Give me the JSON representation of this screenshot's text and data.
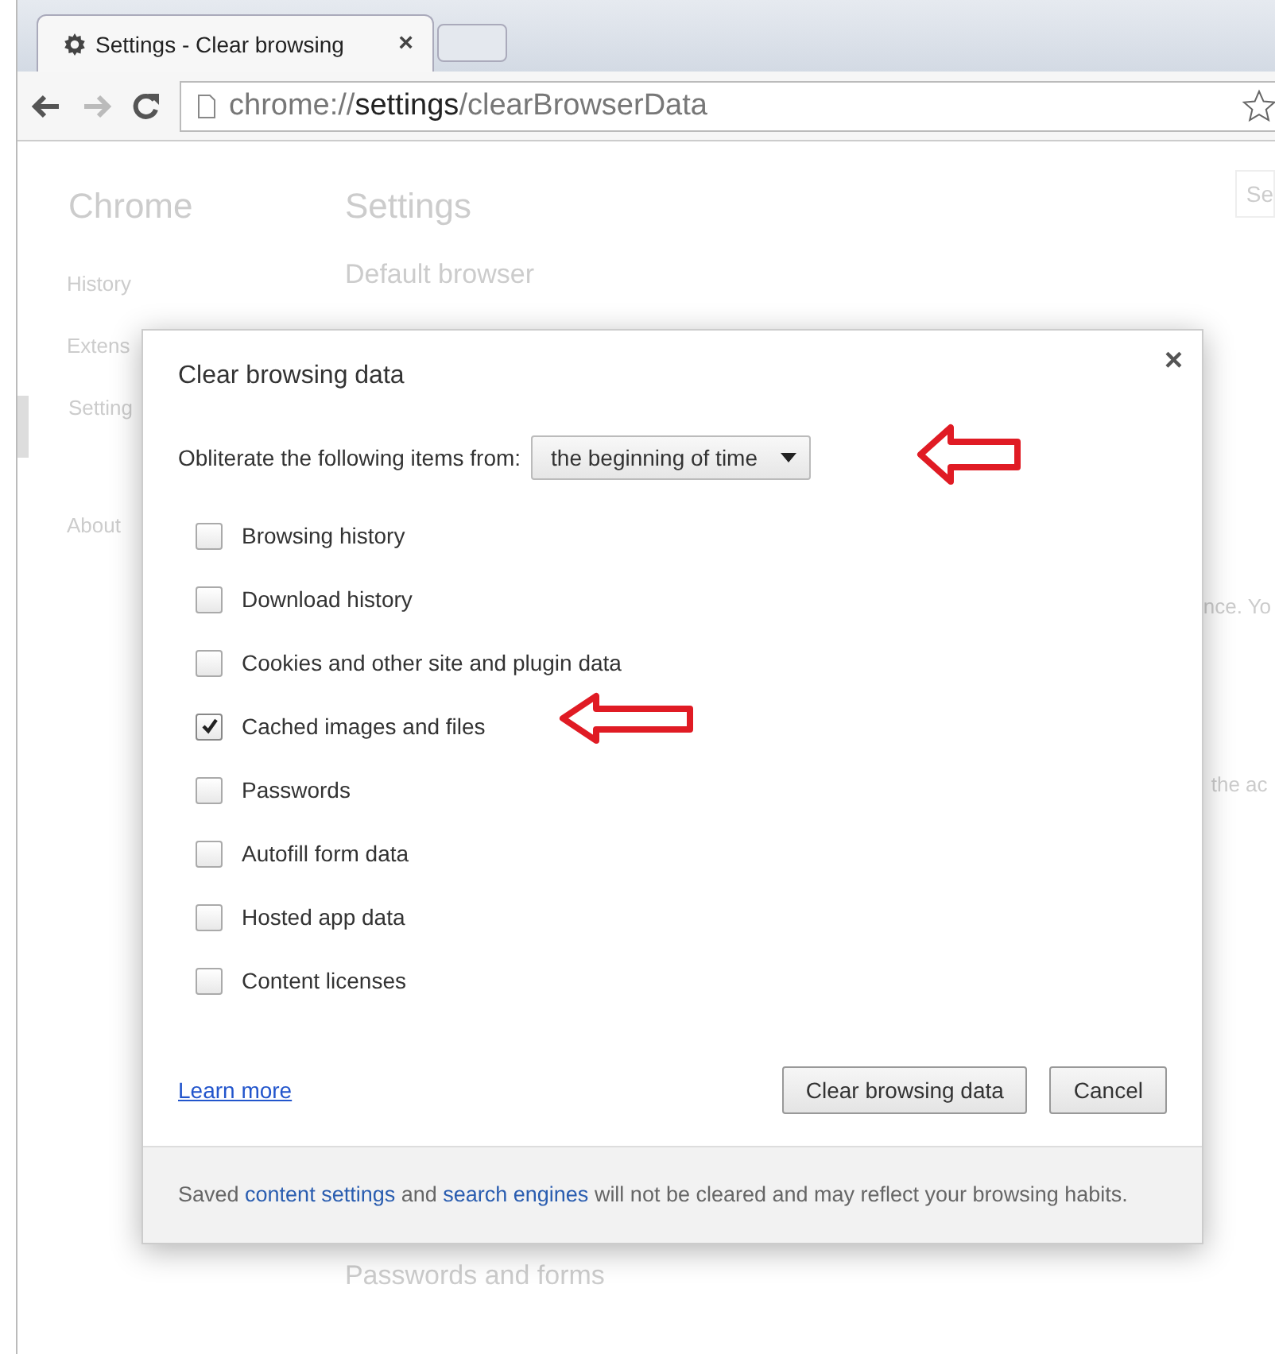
{
  "tab": {
    "title": "Settings - Clear browsing",
    "close": "×"
  },
  "address_bar": {
    "url": "chrome://**settings**/clearBrowserData"
  },
  "page": {
    "brand": "Chrome",
    "heading": "Settings",
    "search": {
      "placeholder": "Se"
    },
    "sidebar": [
      {
        "label": "History",
        "selected": false
      },
      {
        "label": "Extens",
        "selected": false
      },
      {
        "label": "Setting",
        "selected": true
      },
      {
        "label": "About",
        "selected": false
      }
    ],
    "sections": [
      "Default browser",
      "Passwords and forms"
    ],
    "fragments": [
      "nce. Yo",
      "the ac"
    ]
  },
  "dialog": {
    "title": "Clear browsing data",
    "close": "×",
    "period_label": "Obliterate the following items from:",
    "period": "the beginning of time",
    "items": [
      {
        "label": "Browsing history",
        "checked": false
      },
      {
        "label": "Download history",
        "checked": false
      },
      {
        "label": "Cookies and other site and plugin data",
        "checked": false
      },
      {
        "label": "Cached images and files",
        "checked": true
      },
      {
        "label": "Passwords",
        "checked": false
      },
      {
        "label": "Autofill form data",
        "checked": false
      },
      {
        "label": "Hosted app data",
        "checked": false
      },
      {
        "label": "Content licenses",
        "checked": false
      }
    ],
    "learn_more": "Learn more",
    "buttons": [
      "Clear browsing data",
      "Cancel"
    ],
    "footer": [
      {
        "kind": "text",
        "text": "Saved "
      },
      {
        "kind": "link",
        "text": "content settings"
      },
      {
        "kind": "text",
        "text": " and "
      },
      {
        "kind": "link",
        "text": "search engines"
      },
      {
        "kind": "text",
        "text": " will not be cleared and may reflect your browsing habits."
      }
    ]
  }
}
